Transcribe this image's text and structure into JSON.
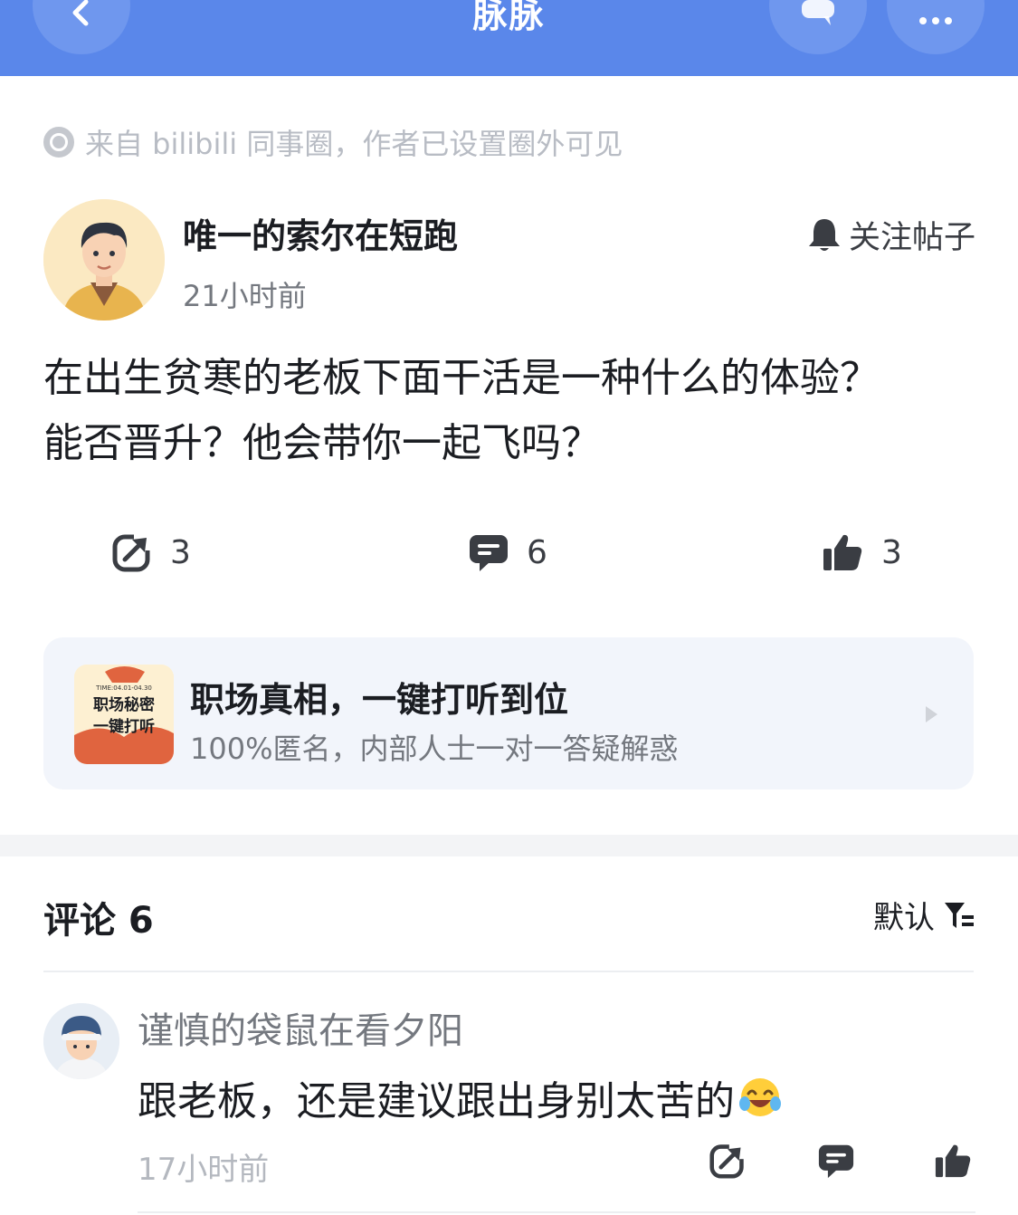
{
  "header": {
    "title": "脉脉",
    "back_icon": "chevron-left-icon",
    "message_icon": "message-icon",
    "more_icon": "more-icon"
  },
  "post": {
    "source": "来自 bilibili 同事圈，作者已设置圈外可见",
    "author_name": "唯一的索尔在短跑",
    "author_time": "21小时前",
    "follow_label": "关注帖子",
    "text_line1": "在出生贫寒的老板下面干活是一种什么的体验？",
    "text_line2": "能否晋升？他会带你一起飞吗？",
    "share_count": "3",
    "comment_count": "6",
    "like_count": "3"
  },
  "promo": {
    "title": "职场真相，一键打听到位",
    "subtitle": "100%匿名，内部人士一对一答疑解惑",
    "image_text_top": "TIME:04.01-04.30",
    "image_text_line1": "职场秘密",
    "image_text_line2": "一键打听"
  },
  "comments": {
    "header": "评论 6",
    "sort_label": "默认",
    "items": [
      {
        "name": "谨慎的袋鼠在看夕阳",
        "text": "跟老板，还是建议跟出身别太苦的",
        "emoji": "😂",
        "time": "17小时前"
      }
    ]
  },
  "colors": {
    "header_bg": "#5a87ea",
    "promo_bg": "#f2f5fb",
    "icon_dark": "#3a3d43"
  }
}
